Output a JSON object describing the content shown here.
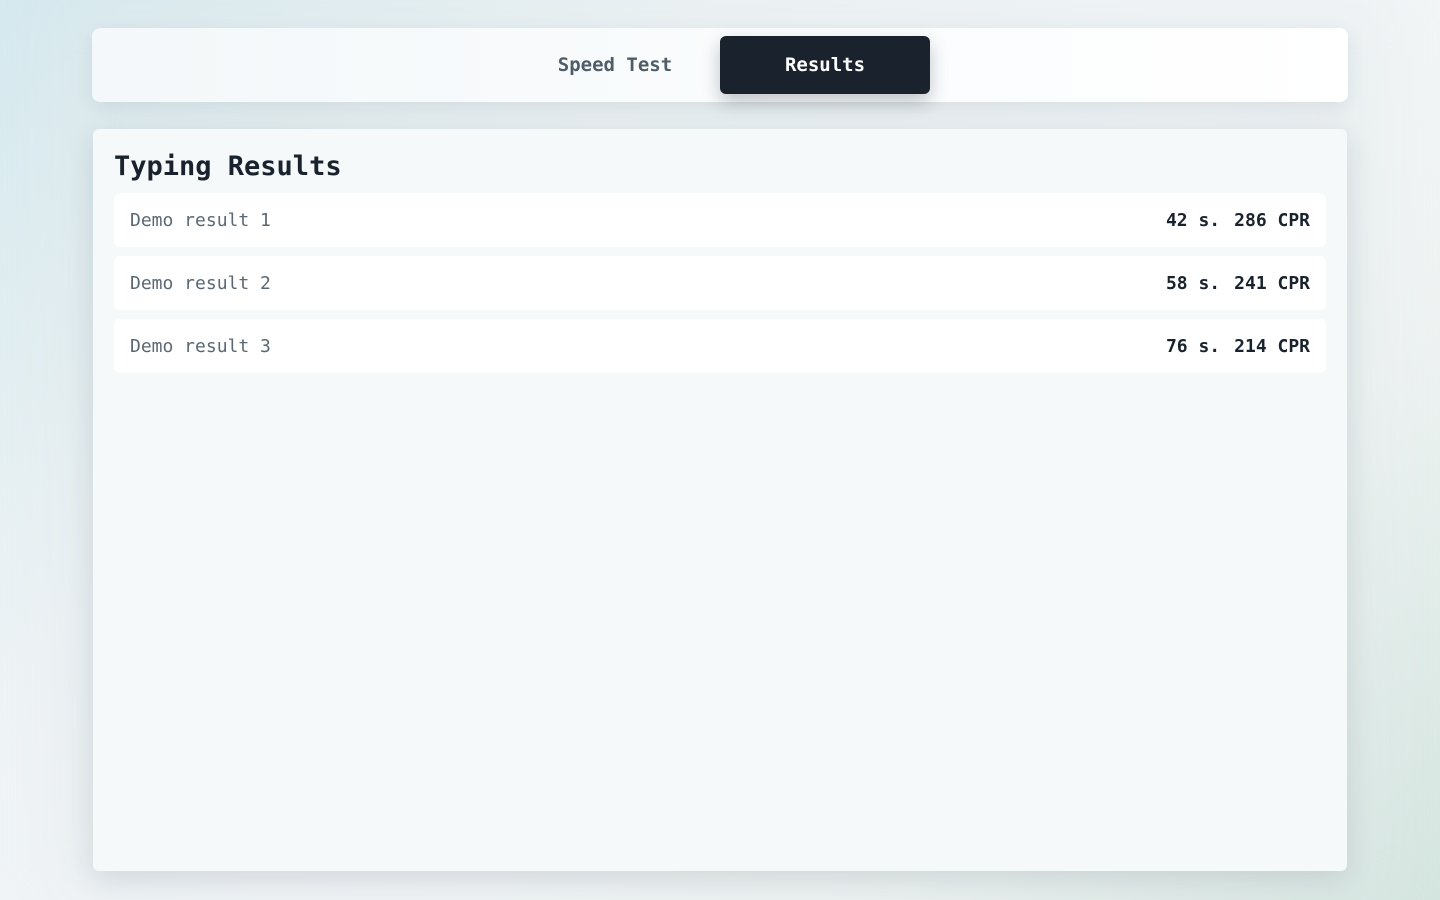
{
  "tabs": [
    {
      "label": "Speed Test",
      "active": false
    },
    {
      "label": "Results",
      "active": true
    }
  ],
  "results_panel": {
    "title": "Typing Results",
    "rows": [
      {
        "name": "Demo result 1",
        "time": "42 s.",
        "cpr": "286 CPR"
      },
      {
        "name": "Demo result 2",
        "time": "58 s.",
        "cpr": "241 CPR"
      },
      {
        "name": "Demo result 3",
        "time": "76 s.",
        "cpr": "214 CPR"
      }
    ]
  },
  "colors": {
    "active_tab_bg": "#1a232d",
    "text_dark": "#1a232d",
    "text_muted": "#5b6873"
  }
}
